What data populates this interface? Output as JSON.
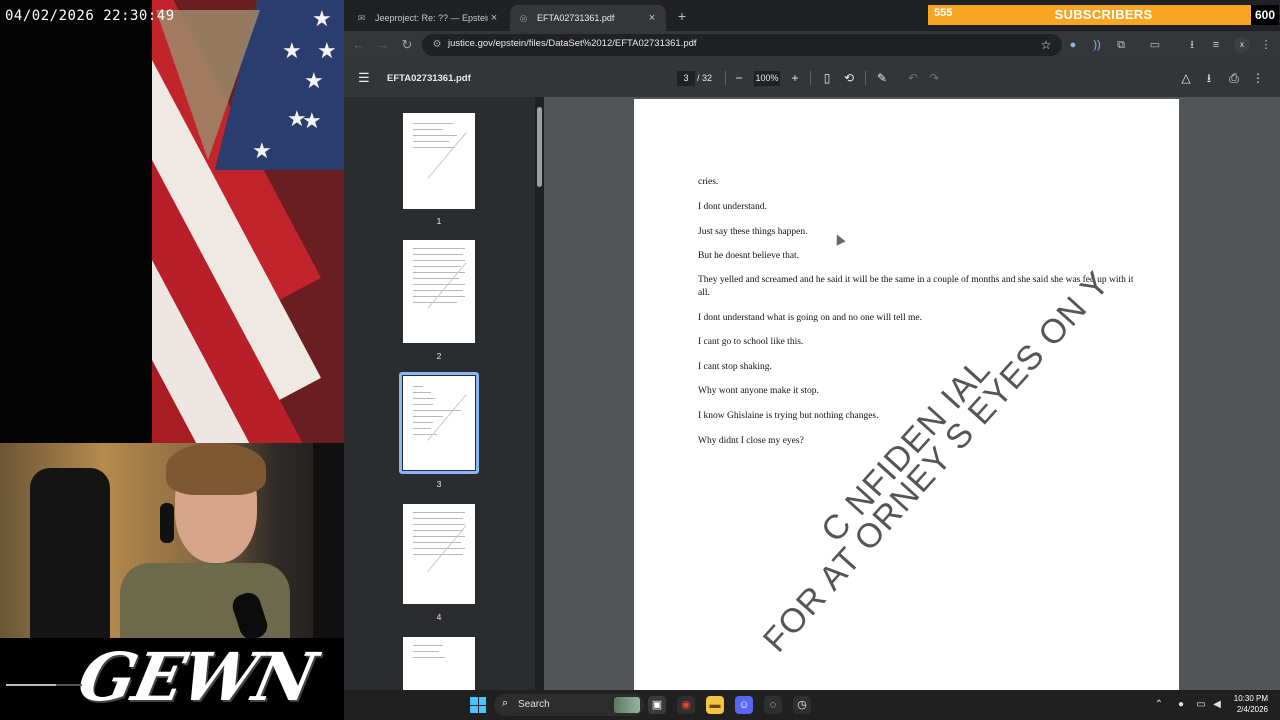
{
  "stream": {
    "datetime": "04/02/2026 22:30:49",
    "logo_text": "GEWN",
    "subscriber_widget": {
      "current": "555",
      "title": "SUBSCRIBERS",
      "goal": "600",
      "color": "#f6a623"
    }
  },
  "browser": {
    "tabs": [
      {
        "label": "Jeeproject: Re: ?? — Epstein Em",
        "icon": "mail-icon",
        "active": false
      },
      {
        "label": "EFTA02731361.pdf",
        "icon": "globe-icon",
        "active": true
      }
    ],
    "new_tab_glyph": "+",
    "url": "justice.gov/epstein/files/DataSet%2012/EFTA02731361.pdf",
    "profile_initial": "x"
  },
  "pdf_viewer": {
    "filename": "EFTA02731361.pdf",
    "current_page": "3",
    "total_pages": "/ 32",
    "zoom": "100%",
    "thumbnails": [
      {
        "label": "1",
        "selected": false
      },
      {
        "label": "2",
        "selected": false
      },
      {
        "label": "3",
        "selected": true
      },
      {
        "label": "4",
        "selected": false
      },
      {
        "label": "",
        "selected": false
      }
    ],
    "page_lines": [
      "cries.",
      "I dont understand.",
      "Just say these things happen.",
      "But he doesnt believe that.",
      "They yelled and screamed and he said it will be the same in a couple of months and she said she was fed up with it all.",
      "I dont understand what is going on and no one will tell me.",
      "I cant go to school like this.",
      "I cant stop shaking.",
      "Why wont anyone make it stop.",
      "I know Ghislaine is trying but nothing changes.",
      "Why didnt I close my eyes?"
    ],
    "watermark_line1": "C  NFIDEN  IAL",
    "watermark_line2": "FOR AT  ORNEY S EYES ON  Y"
  },
  "taskbar": {
    "search_label": "Search",
    "time": "10:30 PM",
    "date": "2/4/2026",
    "accent": "#4cc2ff"
  }
}
